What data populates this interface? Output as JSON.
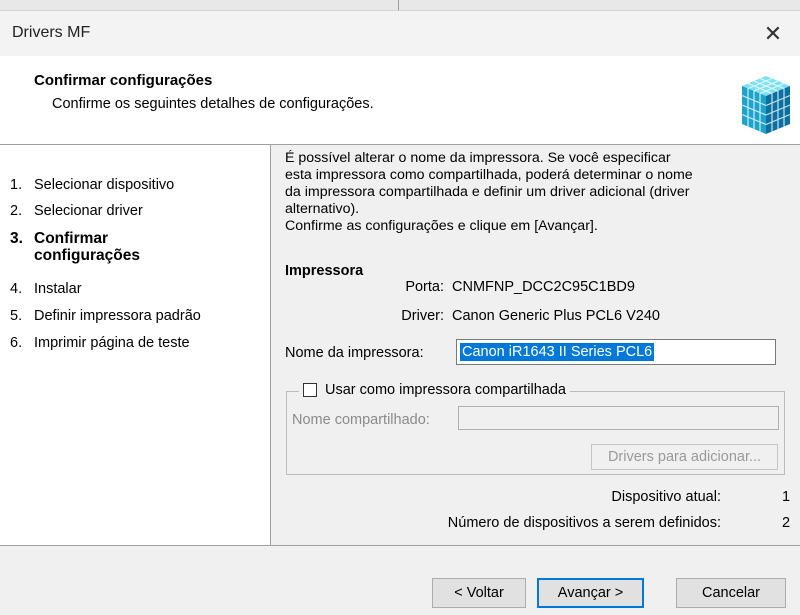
{
  "window": {
    "title": "Drivers MF"
  },
  "header": {
    "title": "Confirmar configurações",
    "subtitle": "Confirme os seguintes detalhes de configurações.",
    "icon": "printer-cube-icon"
  },
  "steps": [
    {
      "num": "1.",
      "label": "Selecionar dispositivo",
      "active": false
    },
    {
      "num": "2.",
      "label": "Selecionar driver",
      "active": false
    },
    {
      "num": "3.",
      "label_line1": "Confirmar",
      "label_line2": "configurações",
      "active": true
    },
    {
      "num": "4.",
      "label": "Instalar",
      "active": false
    },
    {
      "num": "5.",
      "label": "Definir impressora padrão",
      "active": false
    },
    {
      "num": "6.",
      "label": "Imprimir página de teste",
      "active": false
    }
  ],
  "content": {
    "para_lines": [
      "É possível alterar o nome da impressora. Se você especificar",
      "esta impressora como compartilhada, poderá determinar o nome",
      "da impressora compartilhada e definir um driver adicional (driver",
      "alternativo).",
      "Confirme as configurações e clique em [Avançar]."
    ],
    "printer_section": "Impressora",
    "port_label": "Porta:",
    "port_value": "CNMFNP_DCC2C95C1BD9",
    "driver_label": "Driver:",
    "driver_value": "Canon Generic Plus PCL6 V240",
    "printer_name_label": "Nome da impressora:",
    "printer_name_value": "Canon iR1643 II Series PCL6",
    "share_checkbox_label": "Usar como impressora compartilhada",
    "share_checkbox_checked": false,
    "share_name_label": "Nome compartilhado:",
    "share_name_value": "",
    "drivers_button": "Drivers para adicionar...",
    "current_device_label": "Dispositivo atual:",
    "current_device_value": "1",
    "device_count_label": "Número de dispositivos a serem definidos:",
    "device_count_value": "2"
  },
  "buttons": {
    "back": "< Voltar",
    "next": "Avançar >",
    "cancel": "Cancelar"
  },
  "colors": {
    "selection": "#0078d7",
    "accent": "#0078d7"
  }
}
